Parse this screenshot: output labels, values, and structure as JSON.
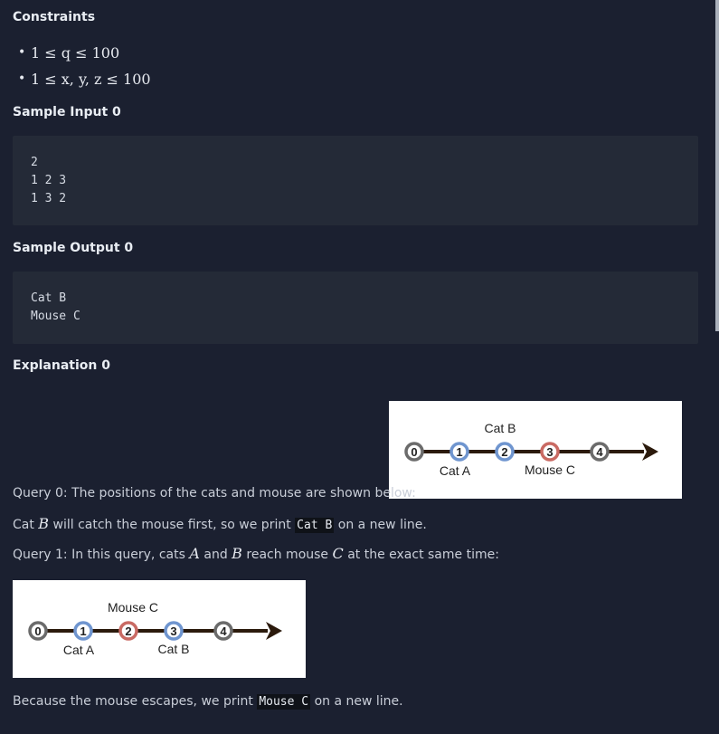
{
  "constraints": {
    "heading": "Constraints",
    "items": [
      "1 ≤ q ≤ 100",
      "1 ≤ x, y, z ≤ 100"
    ]
  },
  "sample_input": {
    "heading": "Sample Input 0",
    "text": "2\n1 2 3\n1 3 2"
  },
  "sample_output": {
    "heading": "Sample Output 0",
    "text": "Cat B\nMouse C"
  },
  "explanation": {
    "heading": "Explanation 0",
    "query0_text": "Query 0: The positions of the cats and mouse are shown below:",
    "query0_result_prefix": "Cat",
    "query0_result_var": "B",
    "query0_result_mid": "will catch the mouse first, so we print",
    "query0_result_code": "Cat B",
    "query0_result_suffix": "on a new line.",
    "query1_prefix": "Query 1: In this query, cats",
    "query1_var_a": "A",
    "query1_and": "and",
    "query1_var_b": "B",
    "query1_mid": "reach mouse",
    "query1_var_c": "C",
    "query1_suffix": "at the exact same time:",
    "final_prefix": "Because the mouse escapes, we print",
    "final_code": "Mouse C",
    "final_suffix": "on a new line."
  },
  "figure1": {
    "nodes": [
      "0",
      "1",
      "2",
      "3",
      "4"
    ],
    "label_above": "Cat B",
    "label_below_1": "Cat A",
    "label_below_2": "Mouse C"
  },
  "figure2": {
    "nodes": [
      "0",
      "1",
      "2",
      "3",
      "4"
    ],
    "label_above": "Mouse C",
    "label_below_1": "Cat A",
    "label_below_2": "Cat B"
  },
  "colors": {
    "page_bg": "#1b2030",
    "code_bg": "#242a37",
    "node_gray": "#6b6b6b",
    "node_blue": "#6f95cf",
    "node_red": "#c96a63",
    "axis_line": "#2b1a0c"
  }
}
